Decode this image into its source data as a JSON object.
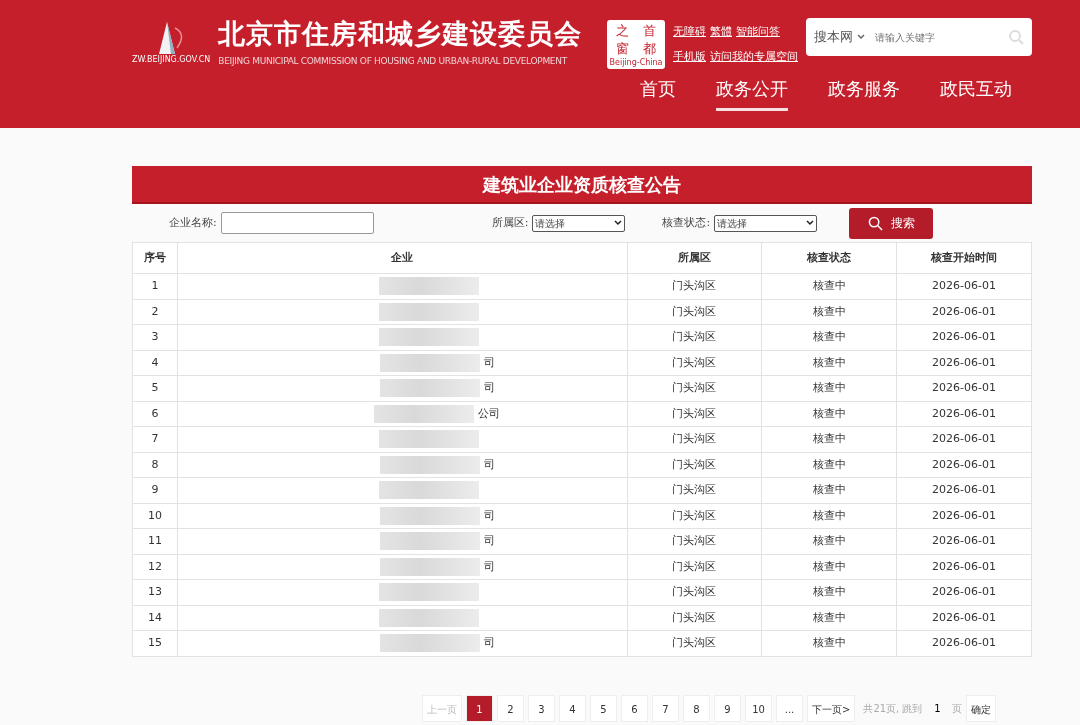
{
  "header": {
    "title": "北京市住房和城乡建设委员会",
    "subtitle": "BEIJING MUNICIPAL COMMISSION OF HOUSING AND URBAN-RURAL DEVELOPMENT",
    "logo_caption": "ZW.BEIJING.GOV.CN",
    "seal": {
      "chars": [
        "之",
        "首",
        "窗",
        "都"
      ],
      "caption": "Beijing-China"
    },
    "quick_links": [
      [
        "无障碍",
        "繁體",
        "智能问答"
      ],
      [
        "手机版",
        "访问我的专属空间"
      ]
    ],
    "search": {
      "scope": "搜本网",
      "placeholder": "请输入关键字"
    },
    "nav": [
      {
        "label": "首页",
        "selected": false
      },
      {
        "label": "政务公开",
        "selected": true
      },
      {
        "label": "政务服务",
        "selected": false
      },
      {
        "label": "政民互动",
        "selected": false
      }
    ]
  },
  "panel_title": "建筑业企业资质核查公告",
  "filters": {
    "name_label": "企业名称:",
    "district_label": "所属区:",
    "district_value": "请选择",
    "status_label": "核查状态:",
    "status_value": "请选择",
    "search_button": "搜索"
  },
  "table": {
    "columns": [
      "序号",
      "企业",
      "所属区",
      "核查状态",
      "核查开始时间"
    ],
    "rows": [
      {
        "no": "1",
        "company": "",
        "district": "门头沟区",
        "status": "核查中",
        "date": "2026-06-01"
      },
      {
        "no": "2",
        "company": "",
        "district": "门头沟区",
        "status": "核查中",
        "date": "2026-06-01"
      },
      {
        "no": "3",
        "company": "",
        "district": "门头沟区",
        "status": "核查中",
        "date": "2026-06-01"
      },
      {
        "no": "4",
        "company": "司",
        "district": "门头沟区",
        "status": "核查中",
        "date": "2026-06-01"
      },
      {
        "no": "5",
        "company": "司",
        "district": "门头沟区",
        "status": "核查中",
        "date": "2026-06-01"
      },
      {
        "no": "6",
        "company": "公司",
        "district": "门头沟区",
        "status": "核查中",
        "date": "2026-06-01"
      },
      {
        "no": "7",
        "company": "",
        "district": "门头沟区",
        "status": "核查中",
        "date": "2026-06-01"
      },
      {
        "no": "8",
        "company": "司",
        "district": "门头沟区",
        "status": "核查中",
        "date": "2026-06-01"
      },
      {
        "no": "9",
        "company": "",
        "district": "门头沟区",
        "status": "核查中",
        "date": "2026-06-01"
      },
      {
        "no": "10",
        "company": "司",
        "district": "门头沟区",
        "status": "核查中",
        "date": "2026-06-01"
      },
      {
        "no": "11",
        "company": "司",
        "district": "门头沟区",
        "status": "核查中",
        "date": "2026-06-01"
      },
      {
        "no": "12",
        "company": "司",
        "district": "门头沟区",
        "status": "核查中",
        "date": "2026-06-01"
      },
      {
        "no": "13",
        "company": "",
        "district": "门头沟区",
        "status": "核查中",
        "date": "2026-06-01"
      },
      {
        "no": "14",
        "company": "",
        "district": "门头沟区",
        "status": "核查中",
        "date": "2026-06-01"
      },
      {
        "no": "15",
        "company": "司",
        "district": "门头沟区",
        "status": "核查中",
        "date": "2026-06-01"
      }
    ]
  },
  "pagination": {
    "prev": {
      "label": "上一页",
      "disabled": true
    },
    "pages": [
      {
        "label": "1",
        "selected": true
      },
      {
        "label": "2",
        "selected": false
      },
      {
        "label": "3",
        "selected": false
      },
      {
        "label": "4",
        "selected": false
      },
      {
        "label": "5",
        "selected": false
      },
      {
        "label": "6",
        "selected": false
      },
      {
        "label": "7",
        "selected": false
      },
      {
        "label": "8",
        "selected": false
      },
      {
        "label": "9",
        "selected": false
      },
      {
        "label": "10",
        "selected": false
      }
    ],
    "ellipsis": "...",
    "next": {
      "label": "下一页>",
      "disabled": false
    },
    "total": "共21页, 跳到",
    "jump_value": "1",
    "page_unit": "页",
    "confirm": "确定"
  }
}
